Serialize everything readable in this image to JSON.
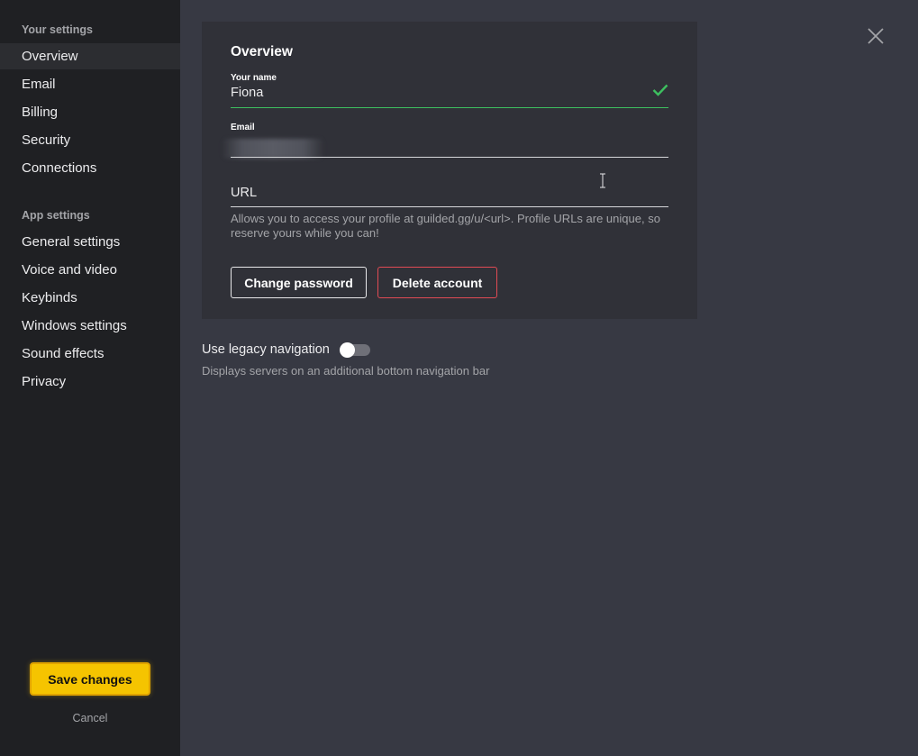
{
  "sidebar": {
    "your_settings_heading": "Your settings",
    "your_settings_items": [
      {
        "label": "Overview",
        "active": true
      },
      {
        "label": "Email"
      },
      {
        "label": "Billing"
      },
      {
        "label": "Security"
      },
      {
        "label": "Connections"
      }
    ],
    "app_settings_heading": "App settings",
    "app_settings_items": [
      {
        "label": "General settings"
      },
      {
        "label": "Voice and video"
      },
      {
        "label": "Keybinds"
      },
      {
        "label": "Windows settings"
      },
      {
        "label": "Sound effects"
      },
      {
        "label": "Privacy"
      }
    ],
    "save_label": "Save changes",
    "cancel_label": "Cancel"
  },
  "overview": {
    "title": "Overview",
    "name_label": "Your name",
    "name_value": "Fiona",
    "email_label": "Email",
    "url_placeholder": "URL",
    "url_help": "Allows you to access your profile at guilded.gg/u/<url>. Profile URLs are unique, so reserve yours while you can!",
    "change_password_label": "Change password",
    "delete_account_label": "Delete account"
  },
  "legacy_nav": {
    "label": "Use legacy navigation",
    "description": "Displays servers on an additional bottom navigation bar",
    "enabled": false
  },
  "icons": {
    "close": "close-icon",
    "check": "check-icon",
    "cursor": "text-cursor-icon"
  },
  "colors": {
    "accent": "#f5c400",
    "success": "#3dbf5f",
    "danger": "#e14b54",
    "sidebar_bg": "#1f2023",
    "main_bg": "#373943",
    "card_bg": "#303138"
  }
}
